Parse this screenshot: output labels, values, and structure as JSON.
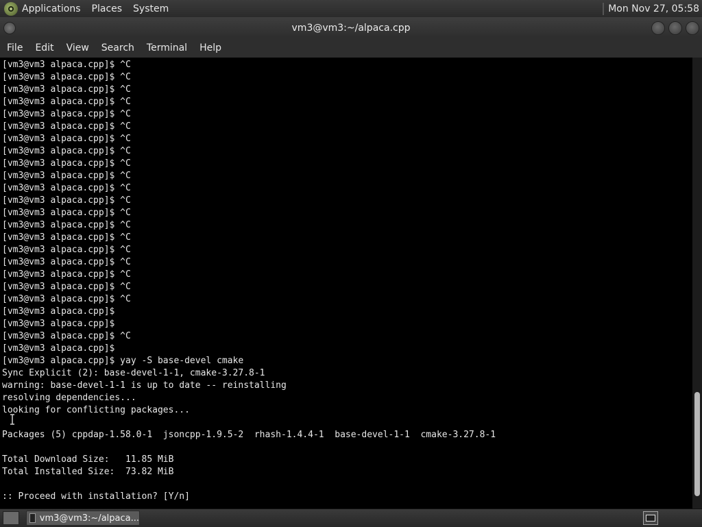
{
  "topbar": {
    "menus": [
      "Applications",
      "Places",
      "System"
    ],
    "clock": "Mon Nov 27, 05:58"
  },
  "window": {
    "title": "vm3@vm3:~/alpaca.cpp"
  },
  "menubar": {
    "items": [
      "File",
      "Edit",
      "View",
      "Search",
      "Terminal",
      "Help"
    ]
  },
  "terminal": {
    "lines": [
      "[vm3@vm3 alpaca.cpp]$ ^C",
      "[vm3@vm3 alpaca.cpp]$ ^C",
      "[vm3@vm3 alpaca.cpp]$ ^C",
      "[vm3@vm3 alpaca.cpp]$ ^C",
      "[vm3@vm3 alpaca.cpp]$ ^C",
      "[vm3@vm3 alpaca.cpp]$ ^C",
      "[vm3@vm3 alpaca.cpp]$ ^C",
      "[vm3@vm3 alpaca.cpp]$ ^C",
      "[vm3@vm3 alpaca.cpp]$ ^C",
      "[vm3@vm3 alpaca.cpp]$ ^C",
      "[vm3@vm3 alpaca.cpp]$ ^C",
      "[vm3@vm3 alpaca.cpp]$ ^C",
      "[vm3@vm3 alpaca.cpp]$ ^C",
      "[vm3@vm3 alpaca.cpp]$ ^C",
      "[vm3@vm3 alpaca.cpp]$ ^C",
      "[vm3@vm3 alpaca.cpp]$ ^C",
      "[vm3@vm3 alpaca.cpp]$ ^C",
      "[vm3@vm3 alpaca.cpp]$ ^C",
      "[vm3@vm3 alpaca.cpp]$ ^C",
      "[vm3@vm3 alpaca.cpp]$ ^C",
      "[vm3@vm3 alpaca.cpp]$",
      "[vm3@vm3 alpaca.cpp]$",
      "[vm3@vm3 alpaca.cpp]$ ^C",
      "[vm3@vm3 alpaca.cpp]$",
      "[vm3@vm3 alpaca.cpp]$ yay -S base-devel cmake",
      "Sync Explicit (2): base-devel-1-1, cmake-3.27.8-1",
      "warning: base-devel-1-1 is up to date -- reinstalling",
      "resolving dependencies...",
      "looking for conflicting packages...",
      "",
      "Packages (5) cppdap-1.58.0-1  jsoncpp-1.9.5-2  rhash-1.4.4-1  base-devel-1-1  cmake-3.27.8-1",
      "",
      "Total Download Size:   11.85 MiB",
      "Total Installed Size:  73.82 MiB",
      "",
      ":: Proceed with installation? [Y/n]"
    ]
  },
  "taskbar": {
    "task_label": "vm3@vm3:~/alpaca..."
  },
  "icons": {
    "logo": "gnome-foot-icon",
    "terminal": "terminal-icon",
    "workspace": "workspace-switcher-icon"
  },
  "colors": {
    "terminal_bg": "#000000",
    "terminal_fg": "#e8e8e8",
    "panel_bg": "#2e2e2e"
  }
}
